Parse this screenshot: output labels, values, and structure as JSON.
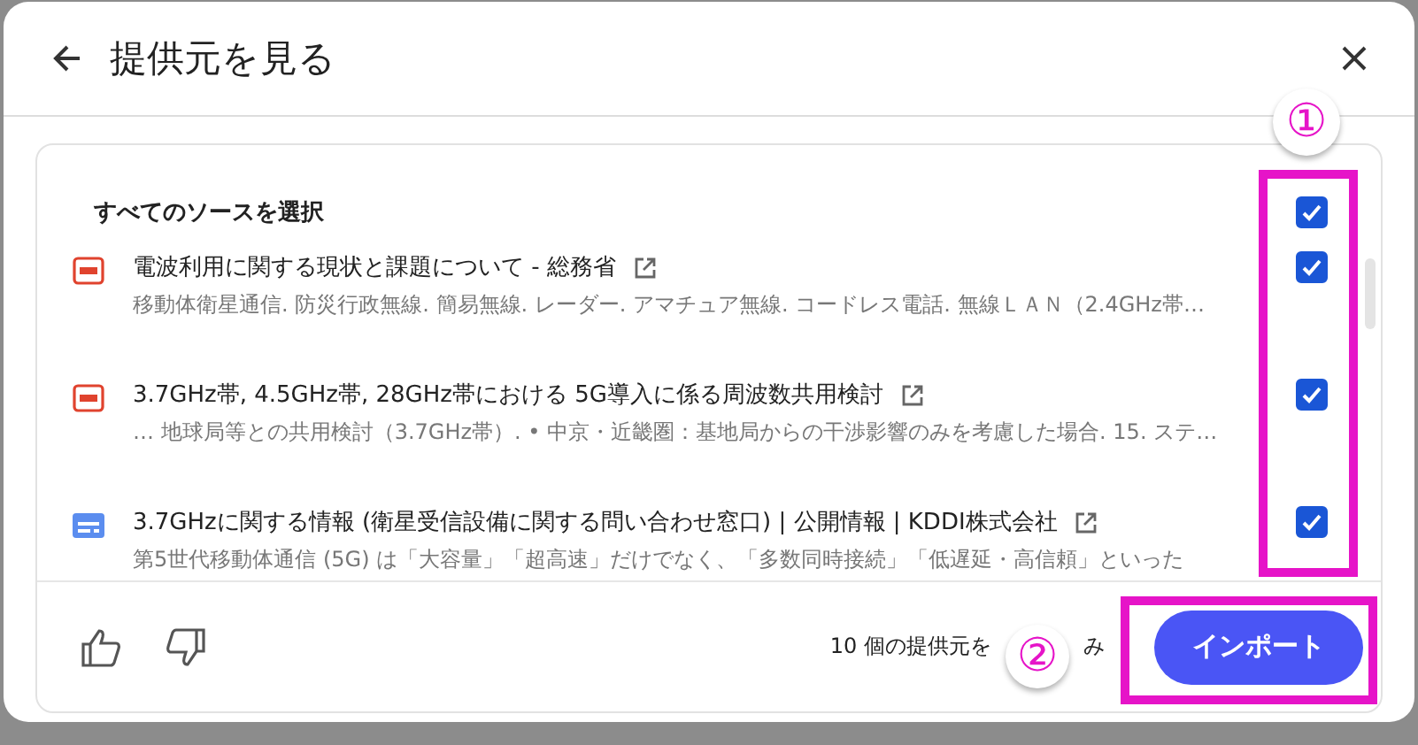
{
  "header": {
    "title": "提供元を見る"
  },
  "select_all": {
    "label": "すべてのソースを選択",
    "checked": true
  },
  "sources": [
    {
      "kind": "pdf",
      "title": "電波利用に関する現状と課題について - 総務省",
      "snippet": "移動体衛星通信. 防災行政無線. 簡易無線. レーダー. アマチュア無線. コードレス電話. 無線ＬＡＮ（2.4GHz帯…",
      "checked": true
    },
    {
      "kind": "pdf",
      "title": "3.7GHz帯, 4.5GHz帯, 28GHz帯における 5G導入に係る周波数共用検討",
      "snippet": "… 地球局等との共用検討（3.7GHz帯）. • 中京・近畿圏：基地局からの干渉影響のみを考慮した場合. 15. ステ…",
      "checked": true
    },
    {
      "kind": "web",
      "title": "3.7GHzに関する情報 (衛星受信設備に関する問い合わせ窓口) | 公開情報 | KDDI株式会社",
      "snippet": "第5世代移動体通信 (5G) は「大容量」「超高速」だけでなく、「多数同時接続」「低遅延・高信頼」といった",
      "checked": true
    }
  ],
  "footer": {
    "count_text": [
      "10 個の提供元を",
      "み"
    ],
    "import_button": "インポート"
  },
  "annotations": [
    {
      "label": "①"
    },
    {
      "label": "②"
    }
  ]
}
